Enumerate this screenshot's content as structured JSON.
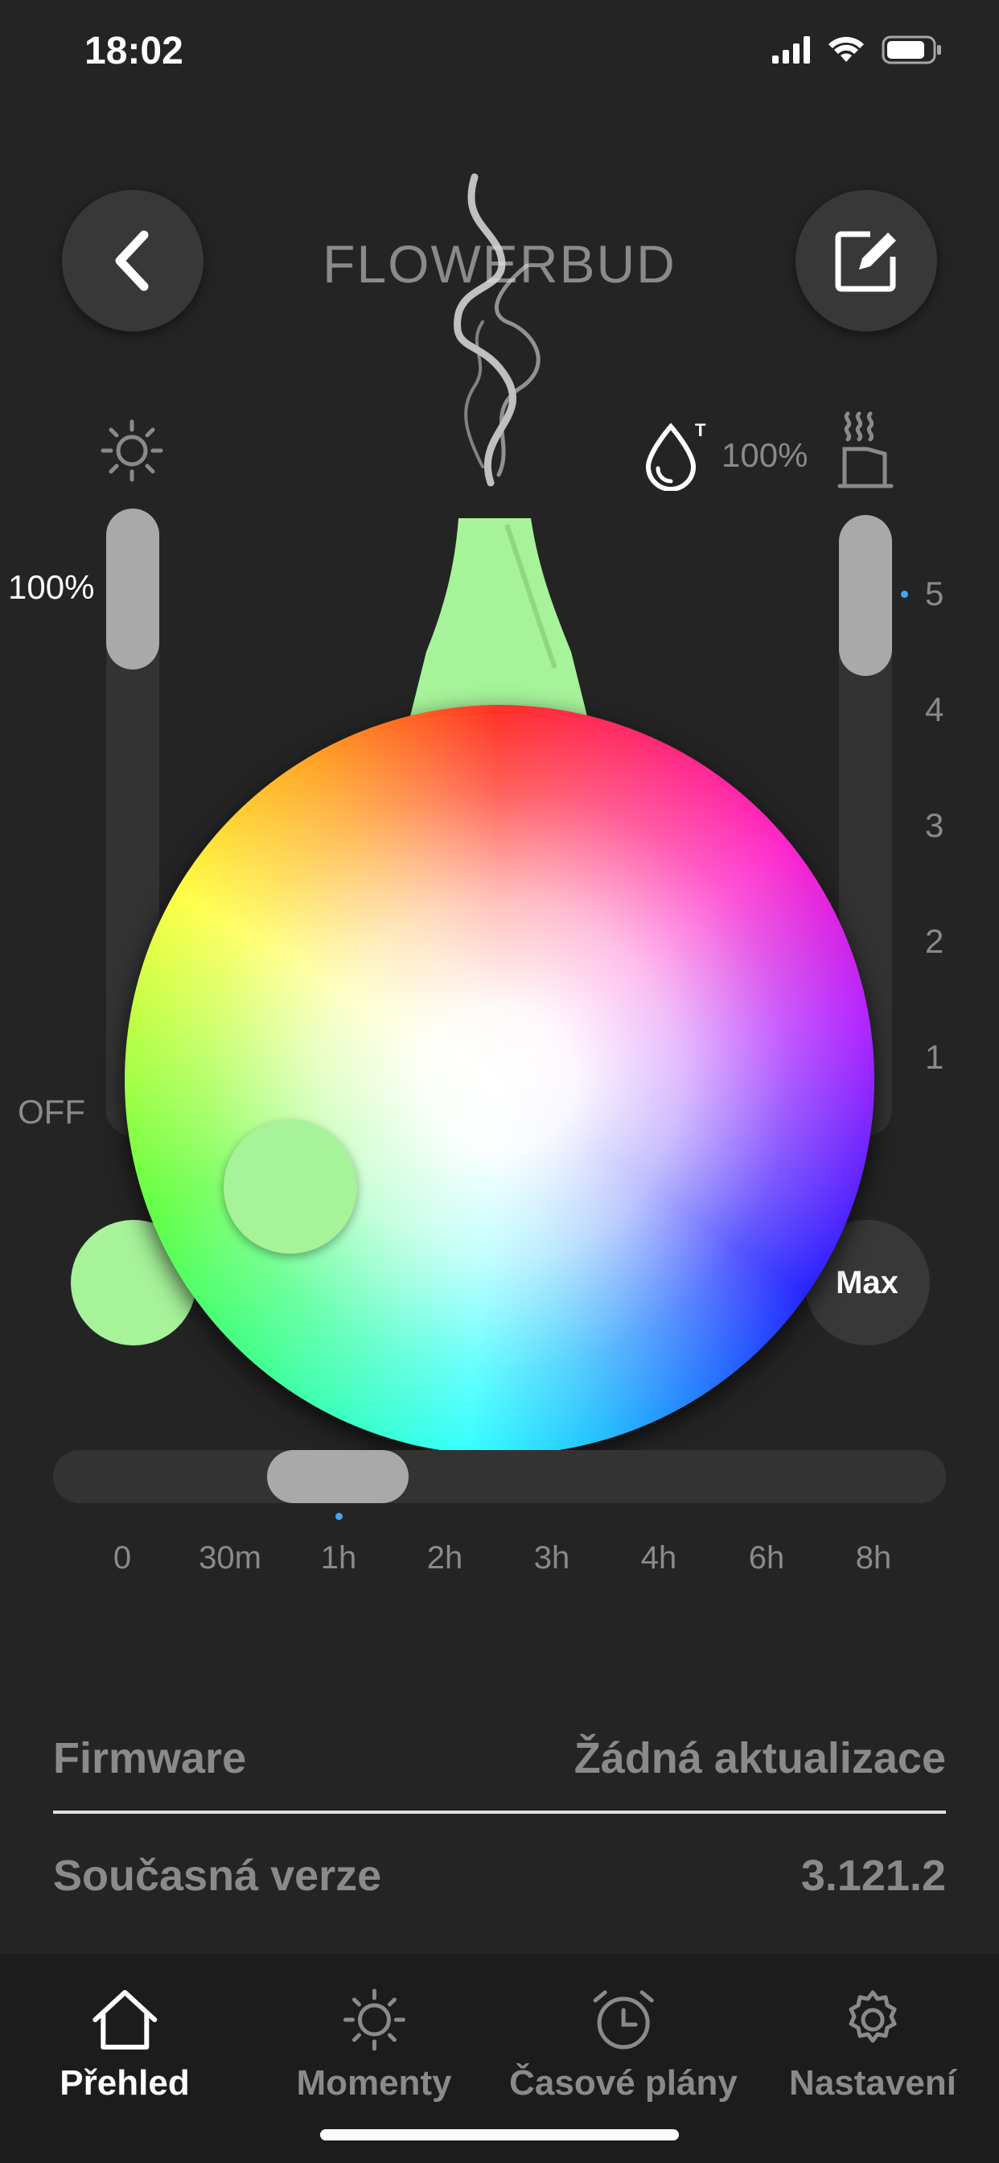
{
  "status_bar": {
    "time": "18:02",
    "battery_level": 0.8
  },
  "header": {
    "title": "FLOWERBUD"
  },
  "brightness": {
    "value_label": "100%",
    "off_label": "OFF",
    "level": 1.0
  },
  "mist": {
    "value_label": "100%",
    "scale": [
      "5",
      "4",
      "3",
      "2",
      "1"
    ],
    "level": 5
  },
  "color": {
    "hex": "#a6f39a"
  },
  "max_button": {
    "label": "Max"
  },
  "timer": {
    "ticks": [
      "0",
      "30m",
      "1h",
      "2h",
      "3h",
      "4h",
      "6h",
      "8h"
    ],
    "selected": "1h"
  },
  "info": {
    "firmware_label": "Firmware",
    "firmware_value": "Žádná aktualizace",
    "version_label": "Současná verze",
    "version_value": "3.121.2"
  },
  "tabbar": {
    "tabs": [
      {
        "label": "Přehled",
        "icon": "home-icon",
        "active": true
      },
      {
        "label": "Momenty",
        "icon": "sun-icon",
        "active": false
      },
      {
        "label": "Časové plány",
        "icon": "alarm-clock-icon",
        "active": false
      },
      {
        "label": "Nastavení",
        "icon": "gear-icon",
        "active": false
      }
    ]
  },
  "colors": {
    "background": "#242424",
    "accent_green": "#a6f39a",
    "thumb_gray": "#a9a9a9",
    "indicator_blue": "#4aa3e8"
  }
}
